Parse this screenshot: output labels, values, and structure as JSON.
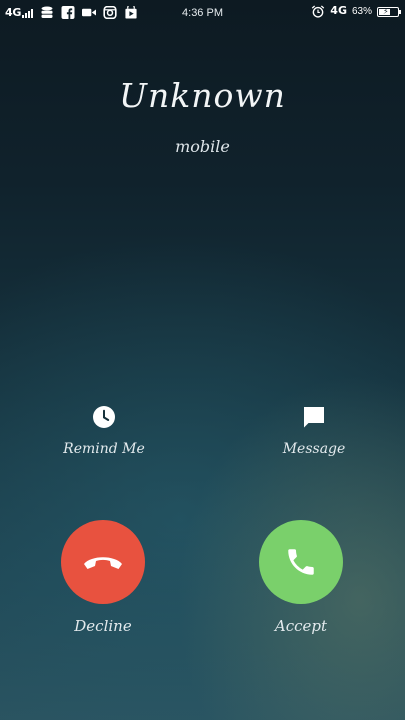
{
  "status_bar": {
    "network_left": "4G",
    "time": "4:36 PM",
    "network_right": "4G",
    "battery_percent": "63%",
    "battery_level": 0.63,
    "left_icons": [
      "signal-icon",
      "database-icon",
      "facebook-icon",
      "video-camera-icon",
      "instagram-icon",
      "play-store-icon"
    ],
    "right_icons": [
      "alarm-icon",
      "battery-icon"
    ]
  },
  "caller": {
    "name": "Unknown",
    "type": "mobile"
  },
  "actions": {
    "remind_label": "Remind Me",
    "remind_icon": "clock-icon",
    "message_label": "Message",
    "message_icon": "message-icon",
    "decline_label": "Decline",
    "decline_icon": "hang-up-icon",
    "accept_label": "Accept",
    "accept_icon": "phone-icon"
  },
  "colors": {
    "decline": "#e8523f",
    "accept": "#7ad06b",
    "background_top": "#0d1a22",
    "background_bottom": "#2a5360"
  }
}
